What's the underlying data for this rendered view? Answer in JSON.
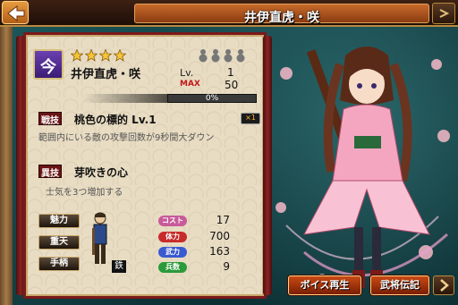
{
  "header": {
    "title": "井伊直虎・咲"
  },
  "card": {
    "rarity": "今",
    "stars": 4,
    "name": "井伊直虎・咲",
    "level_label": "Lv.",
    "level": "1",
    "max_label": "MAX",
    "max_level": "50",
    "exp_text": "0%",
    "exp_fraction": 0.0
  },
  "skill": {
    "tag": "戦技",
    "name": "桃色の標的 Lv.1",
    "multiplier": "×1",
    "description": "範囲内にいる敵の攻撃回数が9秒間大ダウン"
  },
  "trait": {
    "tag": "異技",
    "name": "芽吹きの心",
    "description": "士気を3つ増加する"
  },
  "attributes": [
    "魅力",
    "重天",
    "手柄"
  ],
  "unit_type": "鉄",
  "stats": [
    {
      "label": "コスト",
      "value": "17",
      "color": "#c85a9a"
    },
    {
      "label": "体力",
      "value": "700",
      "color": "#c82a2a"
    },
    {
      "label": "武力",
      "value": "163",
      "color": "#3a5ad0"
    },
    {
      "label": "兵数",
      "value": "9",
      "color": "#2a9a3a"
    }
  ],
  "buttons": {
    "voice": "ボイス再生",
    "biography": "武将伝記"
  },
  "colors": {
    "accent": "#c84a14",
    "panel": "#e8dcc3",
    "frame": "#7a1a1a"
  }
}
